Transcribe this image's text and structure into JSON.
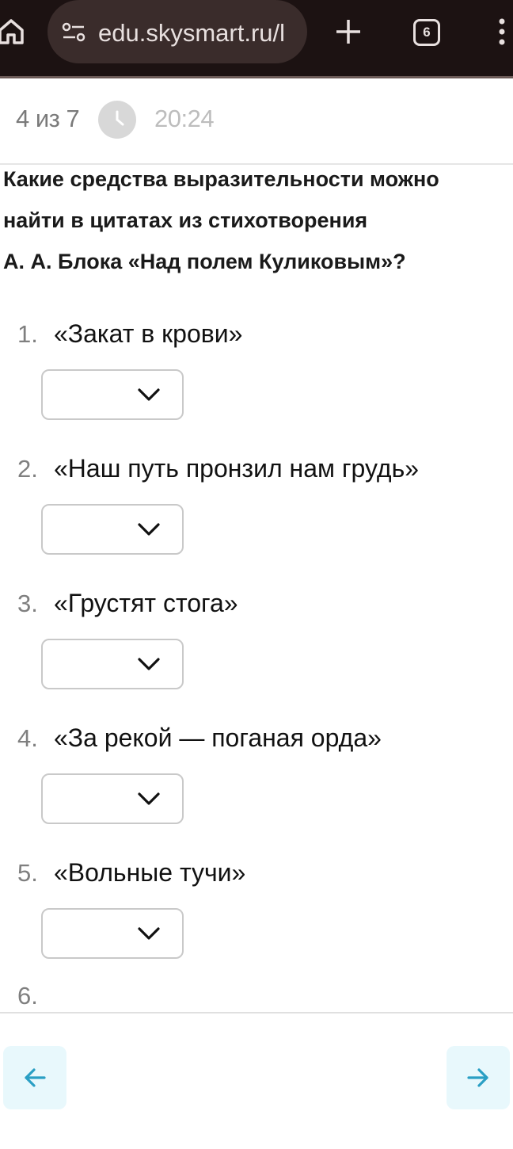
{
  "browser": {
    "url": "edu.skysmart.ru/l",
    "tab_count": "6"
  },
  "progress": {
    "counter": "4 из 7",
    "timer": "20:24"
  },
  "question": {
    "lines": [
      "Какие средства выразительности можно",
      "найти в цитатах из стихотворения",
      "А. А. Блока «Над полем Куликовым»?"
    ]
  },
  "items": [
    {
      "number": "1.",
      "text": "«Закат в крови»",
      "selected": ""
    },
    {
      "number": "2.",
      "text": "«Наш путь пронзил нам грудь»",
      "selected": ""
    },
    {
      "number": "3.",
      "text": "«Грустят стога»",
      "selected": ""
    },
    {
      "number": "4.",
      "text": "«За рекой — поганая орда»",
      "selected": ""
    },
    {
      "number": "5.",
      "text": "«Вольные тучи»",
      "selected": ""
    },
    {
      "number": "6.",
      "text": ""
    }
  ],
  "colors": {
    "browser_bg": "#1c1212",
    "nav_button_bg": "#e8f8fc",
    "nav_arrow": "#2a9fc4"
  },
  "icons": {
    "home": "home-icon",
    "site_settings": "site-settings-icon",
    "new_tab": "plus-icon",
    "more": "more-vertical-icon",
    "timer": "clock-icon",
    "dropdown": "chevron-down-icon",
    "prev": "arrow-left-icon",
    "next": "arrow-right-icon"
  }
}
